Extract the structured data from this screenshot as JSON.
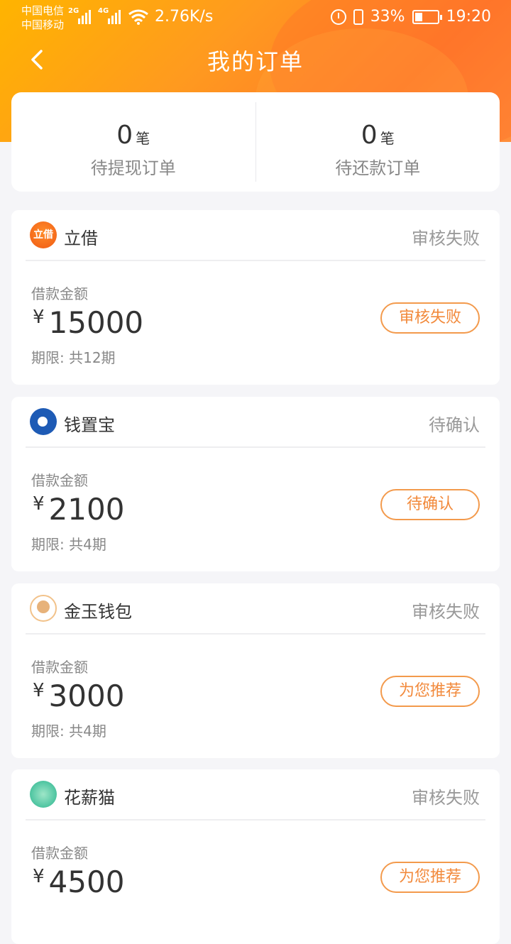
{
  "status_bar": {
    "carrier1": "中国电信",
    "carrier2": "中国移动",
    "sig1_tag": "2G",
    "sig2_tag": "4G",
    "speed": "2.76K/s",
    "battery": "33%",
    "time": "19:20"
  },
  "nav": {
    "title": "我的订单"
  },
  "summary": {
    "pending_withdraw": {
      "count": "0",
      "unit": "笔",
      "label": "待提现订单"
    },
    "pending_repay": {
      "count": "0",
      "unit": "笔",
      "label": "待还款订单"
    }
  },
  "orders": [
    {
      "logo_text": "立借",
      "name": "立借",
      "status": "审核失败",
      "amount_label": "借款金额",
      "currency": "¥",
      "amount": "15000",
      "term": "期限: 共12期",
      "action": "审核失败"
    },
    {
      "name": "钱置宝",
      "status": "待确认",
      "amount_label": "借款金额",
      "currency": "¥",
      "amount": "2100",
      "term": "期限: 共4期",
      "action": "待确认"
    },
    {
      "name": "金玉钱包",
      "status": "审核失败",
      "amount_label": "借款金额",
      "currency": "¥",
      "amount": "3000",
      "term": "期限: 共4期",
      "action": "为您推荐"
    },
    {
      "name": "花薪猫",
      "status": "审核失败",
      "amount_label": "借款金额",
      "currency": "¥",
      "amount": "4500",
      "term": "",
      "action": "为您推荐"
    }
  ],
  "colors": {
    "accent": "#f28a3c",
    "header_start": "#ffb400",
    "header_end": "#ff7a2a"
  }
}
